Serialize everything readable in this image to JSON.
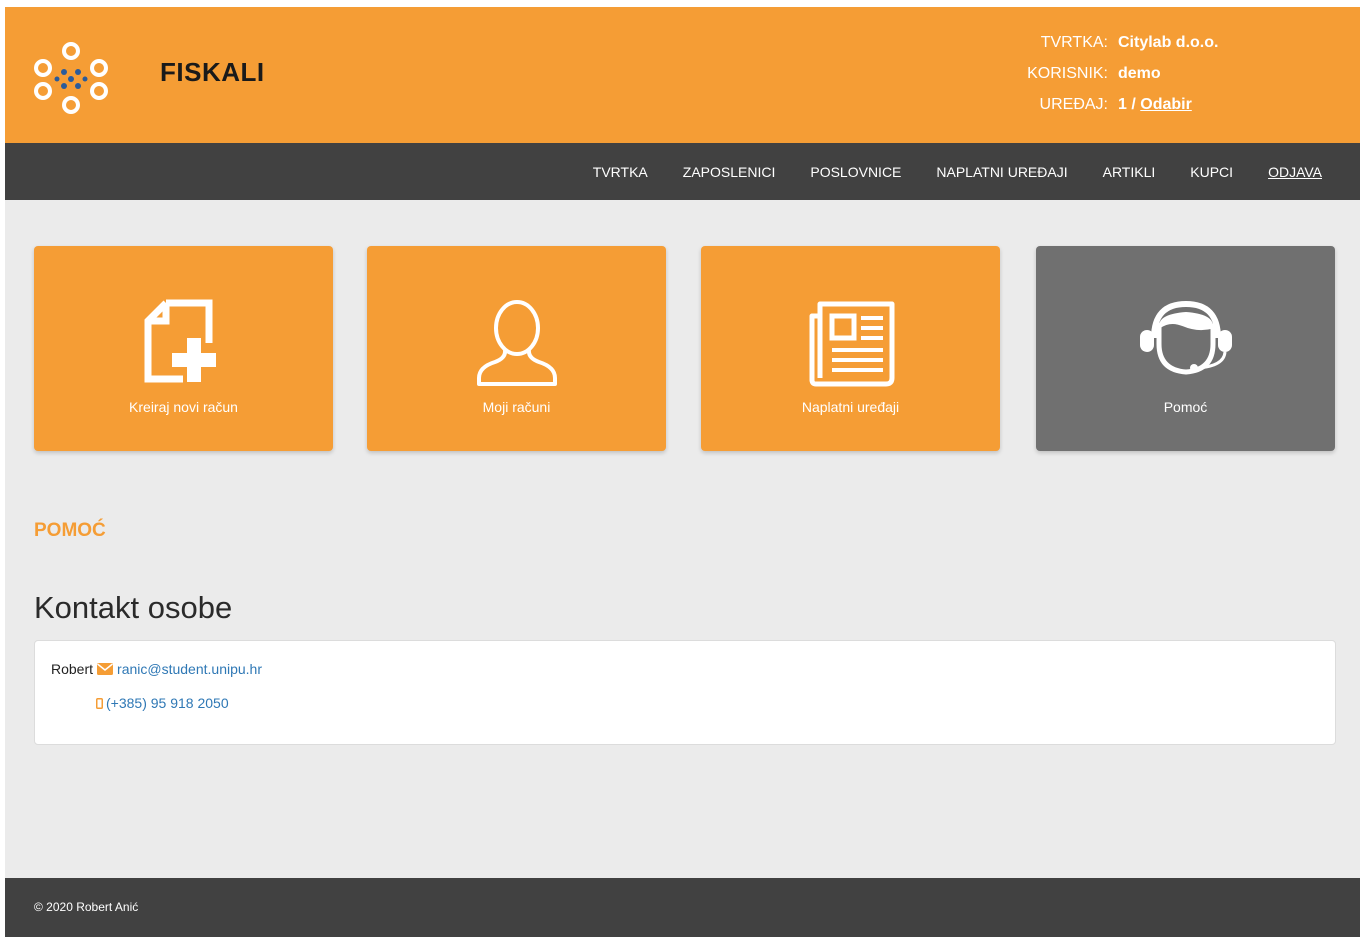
{
  "header": {
    "brand": "FISKALI",
    "company_label": "TVRTKA:",
    "company_value": "Citylab d.o.o.",
    "user_label": "KORISNIK:",
    "user_value": "demo",
    "device_label": "UREĐAJ:",
    "device_value": "1 /",
    "device_link": "Odabir"
  },
  "nav": {
    "items": [
      "TVRTKA",
      "ZAPOSLENICI",
      "POSLOVNICE",
      "NAPLATNI UREĐAJI",
      "ARTIKLI",
      "KUPCI",
      "ODJAVA"
    ]
  },
  "tiles": [
    {
      "label": "Kreiraj novi račun",
      "icon": "new-document-icon"
    },
    {
      "label": "Moji računi",
      "icon": "user-icon"
    },
    {
      "label": "Naplatni uređaji",
      "icon": "newspaper-icon"
    },
    {
      "label": "Pomoć",
      "icon": "headset-support-icon"
    }
  ],
  "section_title": "POMOĆ",
  "contacts": {
    "heading": "Kontakt osobe",
    "name": "Robert",
    "email": "ranic@student.unipu.hr",
    "phone": "(+385) 95 918 2050"
  },
  "footer": {
    "text": "© 2020 Robert Anić"
  },
  "colors": {
    "accent": "#f59d35",
    "dark": "#414141",
    "tile_gray": "#707070",
    "link": "#2f78b5"
  }
}
